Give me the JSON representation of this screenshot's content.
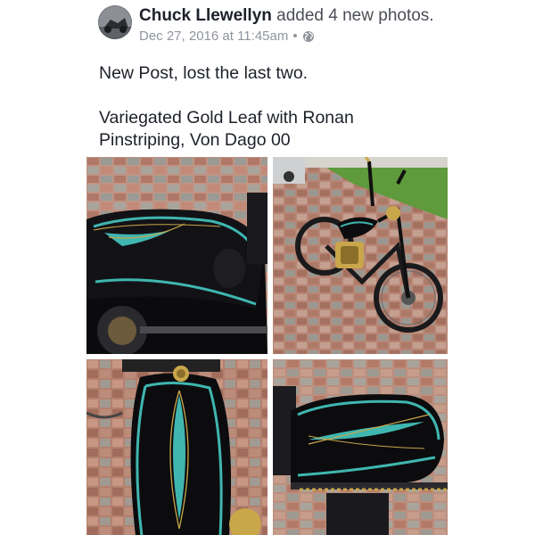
{
  "post": {
    "author": "Chuck Llewellyn",
    "action": " added 4 new photos.",
    "timestamp": "Dec 27, 2016 at 11:45am",
    "separator": "•",
    "privacy_icon": "globe-icon",
    "text_line1": "New Post, lost the last two.",
    "text_line2": "Variegated Gold Leaf with Ronan",
    "text_line3": "Pinstriping, Von Dago 00"
  },
  "photos": [
    {
      "subject": "gas-tank-side-view"
    },
    {
      "subject": "full-motorcycle-driveway"
    },
    {
      "subject": "gas-tank-top-view"
    },
    {
      "subject": "gas-tank-right-side"
    }
  ],
  "colors": {
    "name": "#1d2129",
    "meta": "#90949c",
    "paver": "#b88c7a",
    "tank": "#0c0c0e",
    "pinstripe": "#3fb6b0",
    "gold": "#c9a64a"
  }
}
